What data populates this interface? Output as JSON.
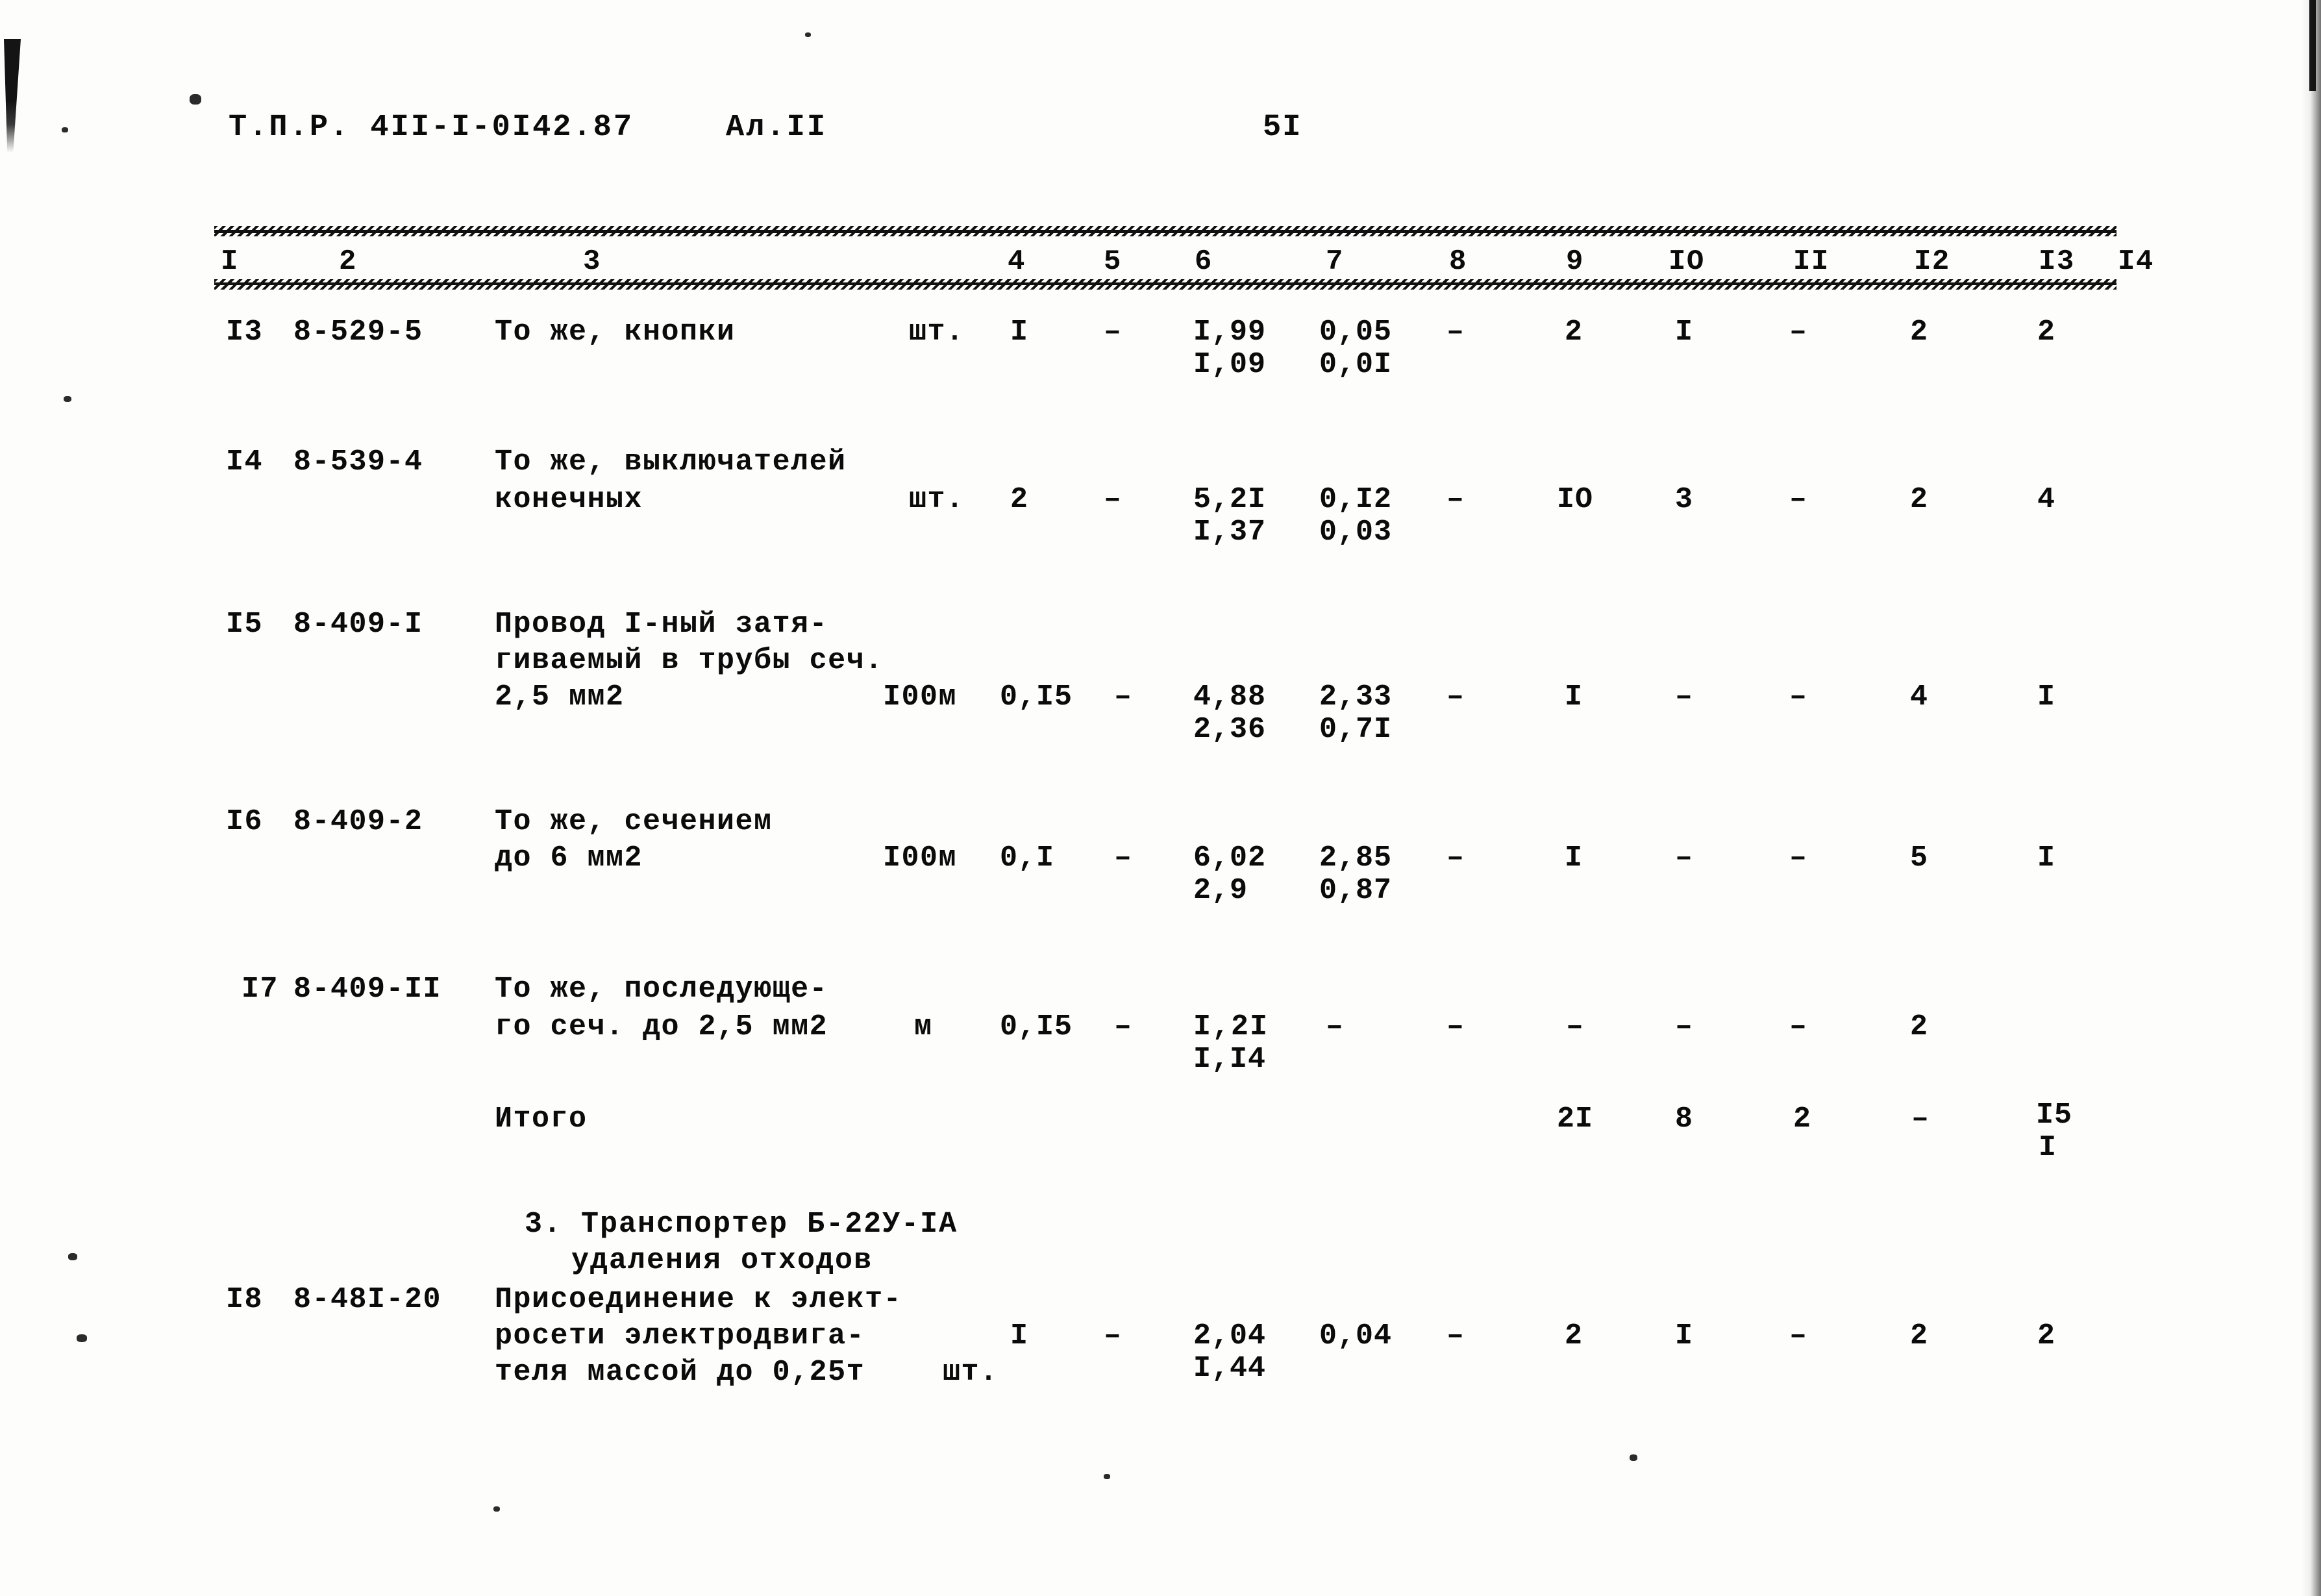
{
  "document": {
    "header_code": "Т.П.Р. 4II-I-0I42.87",
    "header_album": "Ал.II",
    "page_number": "5I"
  },
  "table": {
    "column_headers": [
      "I",
      "2",
      "3",
      "4",
      "5",
      "6",
      "7",
      "8",
      "9",
      "IO",
      "II",
      "I2",
      "I3",
      "I4"
    ],
    "rows": [
      {
        "no": "I3",
        "code": "8-529-5",
        "desc_lines": [
          "То же, кнопки"
        ],
        "unit": "шт.",
        "c4": "I",
        "c5": "–",
        "c6_top": "I,99",
        "c6_bot": "I,09",
        "c7_top": "0,05",
        "c7_bot": "0,0I",
        "c8": "–",
        "c9": "2",
        "c10": "I",
        "c11": "–",
        "c12": "2",
        "c13": "2",
        "c14": ""
      },
      {
        "no": "I4",
        "code": "8-539-4",
        "desc_lines": [
          "То же, выключателей",
          "конечных"
        ],
        "unit": "шт.",
        "c4": "2",
        "c5": "–",
        "c6_top": "5,2I",
        "c6_bot": "I,37",
        "c7_top": "0,I2",
        "c7_bot": "0,03",
        "c8": "–",
        "c9": "IO",
        "c10": "3",
        "c11": "–",
        "c12": "2",
        "c13": "4",
        "c14": ""
      },
      {
        "no": "I5",
        "code": "8-409-I",
        "desc_lines": [
          "Провод I-ный затя-",
          "гиваемый в трубы сеч.",
          "2,5 мм2"
        ],
        "unit": "I00м",
        "c4": "0,I5",
        "c5": "–",
        "c6_top": "4,88",
        "c6_bot": "2,36",
        "c7_top": "2,33",
        "c7_bot": "0,7I",
        "c8": "–",
        "c9": "I",
        "c10": "–",
        "c11": "–",
        "c12": "4",
        "c13": "I",
        "c14": ""
      },
      {
        "no": "I6",
        "code": "8-409-2",
        "desc_lines": [
          "То же, сечением",
          "до 6 мм2"
        ],
        "unit": "I00м",
        "c4": "0,I",
        "c5": "–",
        "c6_top": "6,02",
        "c6_bot": "2,9",
        "c7_top": "2,85",
        "c7_bot": "0,87",
        "c8": "–",
        "c9": "I",
        "c10": "–",
        "c11": "–",
        "c12": "5",
        "c13": "I",
        "c14": ""
      },
      {
        "no": "I7",
        "code": "8-409-II",
        "desc_lines": [
          "То же, последующе-",
          "го сеч. до 2,5 мм2"
        ],
        "unit": "м",
        "c4": "0,I5",
        "c5": "–",
        "c6_top": "I,2I",
        "c6_bot": "I,I4",
        "c7_top": "–",
        "c7_bot": "",
        "c8": "–",
        "c9": "–",
        "c10": "–",
        "c11": "–",
        "c12": "2",
        "c13": "",
        "c14": ""
      }
    ],
    "total_row": {
      "label": "Итого",
      "c9": "2I",
      "c10": "8",
      "c11": "2",
      "c12": "–",
      "c13_top": "I5",
      "c13_bot": "I"
    },
    "section": {
      "title_line1": "3. Транспортер Б-22У-IA",
      "title_line2": "удаления отходов"
    },
    "section_rows": [
      {
        "no": "I8",
        "code": "8-48I-20",
        "desc_lines": [
          "Присоединение к элект-",
          "росети электродвига-",
          "теля массой до 0,25т"
        ],
        "unit": "шт.",
        "c4": "I",
        "c5": "–",
        "c6_top": "2,04",
        "c6_bot": "I,44",
        "c7_top": "0,04",
        "c7_bot": "",
        "c8": "–",
        "c9": "2",
        "c10": "I",
        "c11": "–",
        "c12": "2",
        "c13": "2",
        "c14": ""
      }
    ]
  }
}
